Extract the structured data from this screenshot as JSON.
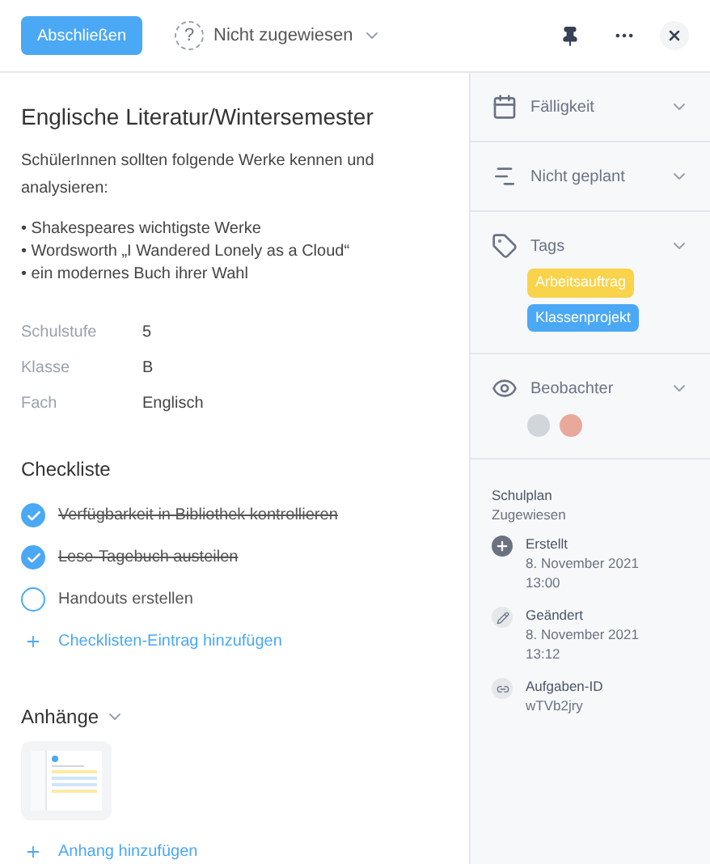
{
  "header": {
    "complete_button": "Abschließen",
    "assignee_icon": "?",
    "assignee": "Nicht zugewiesen"
  },
  "task": {
    "title": "Englische Literatur/Wintersemester",
    "description": "SchülerInnen sollten folgende Werke kennen und analysieren:",
    "bullets": [
      "• Shakespeares wichtigste Werke",
      "• Wordsworth „I Wandered Lonely as a Cloud“",
      "• ein modernes Buch ihrer Wahl"
    ],
    "properties": [
      {
        "label": "Schulstufe",
        "value": "5"
      },
      {
        "label": "Klasse",
        "value": "B"
      },
      {
        "label": "Fach",
        "value": "Englisch"
      }
    ]
  },
  "checklist": {
    "heading": "Checkliste",
    "items": [
      {
        "text": "Verfügbarkeit in Bibliothek kontrollieren",
        "checked": true
      },
      {
        "text": "Lese-Tagebuch austeilen",
        "checked": true
      },
      {
        "text": "Handouts erstellen",
        "checked": false
      }
    ],
    "add_label": "Checklisten-Eintrag hinzufügen"
  },
  "attachments": {
    "heading": "Anhänge",
    "add_label": "Anhang hinzufügen"
  },
  "sidebar": {
    "sections": [
      {
        "kind": "due",
        "label": "Fälligkeit"
      },
      {
        "kind": "plan",
        "label": "Nicht geplant"
      },
      {
        "kind": "tags",
        "label": "Tags",
        "tags": [
          {
            "label": "Arbeitsauftrag",
            "color": "#f9d34a"
          },
          {
            "label": "Klassenprojekt",
            "color": "#4aa8f5"
          }
        ]
      },
      {
        "kind": "watchers",
        "label": "Beobachter"
      }
    ],
    "project": "Schulplan",
    "status": "Zugewiesen",
    "meta": [
      {
        "kind": "created",
        "label": "Erstellt",
        "lines": [
          "8. November 2021",
          "13:00"
        ]
      },
      {
        "kind": "modified",
        "label": "Geändert",
        "lines": [
          "8. November 2021",
          "13:12"
        ]
      },
      {
        "kind": "id",
        "label": "Aufgaben-ID",
        "lines": [
          "wTVb2jry"
        ]
      }
    ]
  }
}
